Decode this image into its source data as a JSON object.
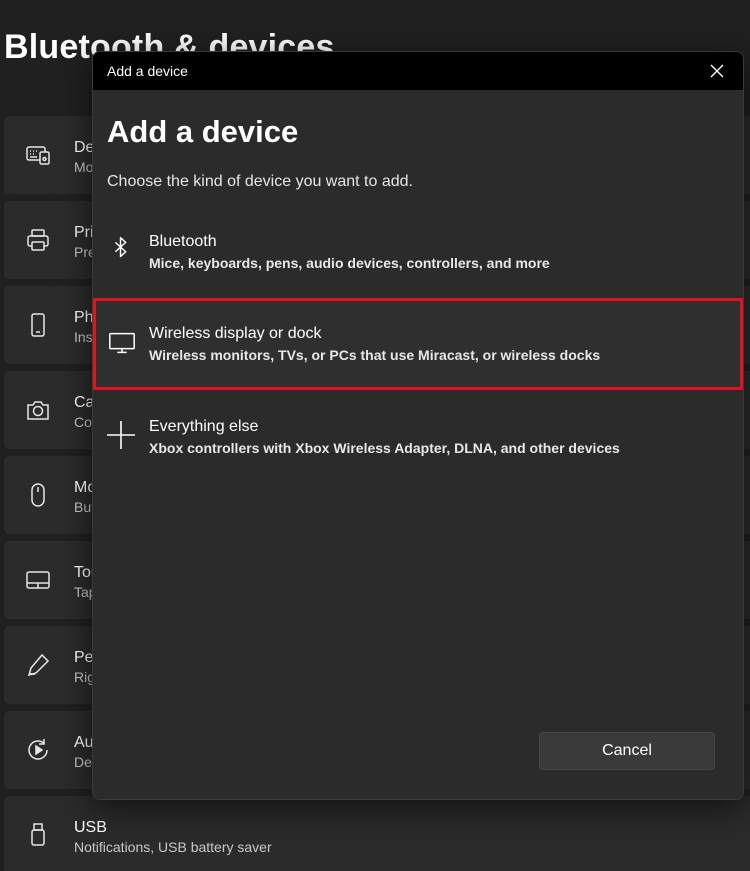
{
  "background": {
    "title": "Bluetooth & devices",
    "items": [
      {
        "name": "De",
        "sub": "Mo",
        "icon": "keyboard-devices-icon"
      },
      {
        "name": "Pri",
        "sub": "Pre",
        "icon": "printer-icon"
      },
      {
        "name": "Ph",
        "sub": "Ins",
        "icon": "phone-icon"
      },
      {
        "name": "Ca",
        "sub": "Co",
        "icon": "camera-icon"
      },
      {
        "name": "Mo",
        "sub": "But",
        "icon": "mouse-icon"
      },
      {
        "name": "Tou",
        "sub": "Tap",
        "icon": "touchpad-icon"
      },
      {
        "name": "Pe",
        "sub": "Rig",
        "icon": "pen-icon"
      },
      {
        "name": "Au",
        "sub": "De",
        "icon": "autoplay-icon"
      },
      {
        "name": "USB",
        "sub": "Notifications, USB battery saver",
        "icon": "usb-icon"
      }
    ]
  },
  "dialog": {
    "window_title": "Add a device",
    "heading": "Add a device",
    "description": "Choose the kind of device you want to add.",
    "options": [
      {
        "title": "Bluetooth",
        "subtitle": "Mice, keyboards, pens, audio devices, controllers, and more",
        "icon": "bluetooth-icon"
      },
      {
        "title": "Wireless display or dock",
        "subtitle": "Wireless monitors, TVs, or PCs that use Miracast, or wireless docks",
        "icon": "monitor-icon",
        "highlighted": true
      },
      {
        "title": "Everything else",
        "subtitle": "Xbox controllers with Xbox Wireless Adapter, DLNA, and other devices",
        "icon": "plus-icon"
      }
    ],
    "cancel_label": "Cancel"
  },
  "colors": {
    "background": "#202020",
    "card": "#2b2b2b",
    "titlebar": "#000000",
    "highlight_border": "#e0141e"
  }
}
